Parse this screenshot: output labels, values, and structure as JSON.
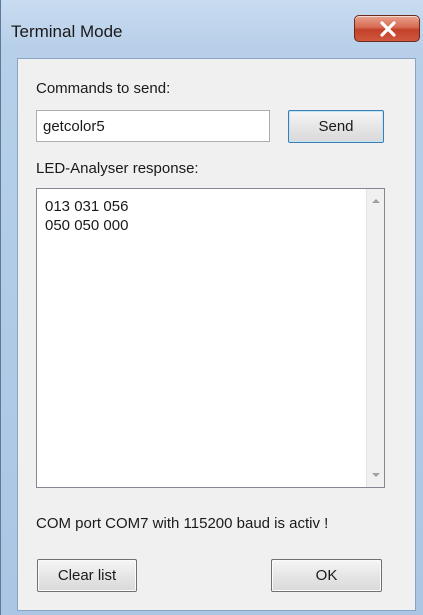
{
  "window": {
    "title": "Terminal Mode"
  },
  "commands": {
    "label": "Commands to send:",
    "input_value": "getcolor5",
    "send_label": "Send"
  },
  "response": {
    "label": "LED-Analyser response:",
    "lines": [
      "013 031 056",
      "050 050 000"
    ]
  },
  "status": "COM port COM7 with 115200 baud is activ !",
  "buttons": {
    "clear_label": "Clear list",
    "ok_label": "OK"
  },
  "icons": {
    "close": "close-icon",
    "scroll_up": "arrow-up-icon",
    "scroll_down": "arrow-down-icon"
  },
  "colors": {
    "close_button": "#c3402a",
    "frame": "#b7cfe9",
    "client": "#f0f0f0"
  }
}
